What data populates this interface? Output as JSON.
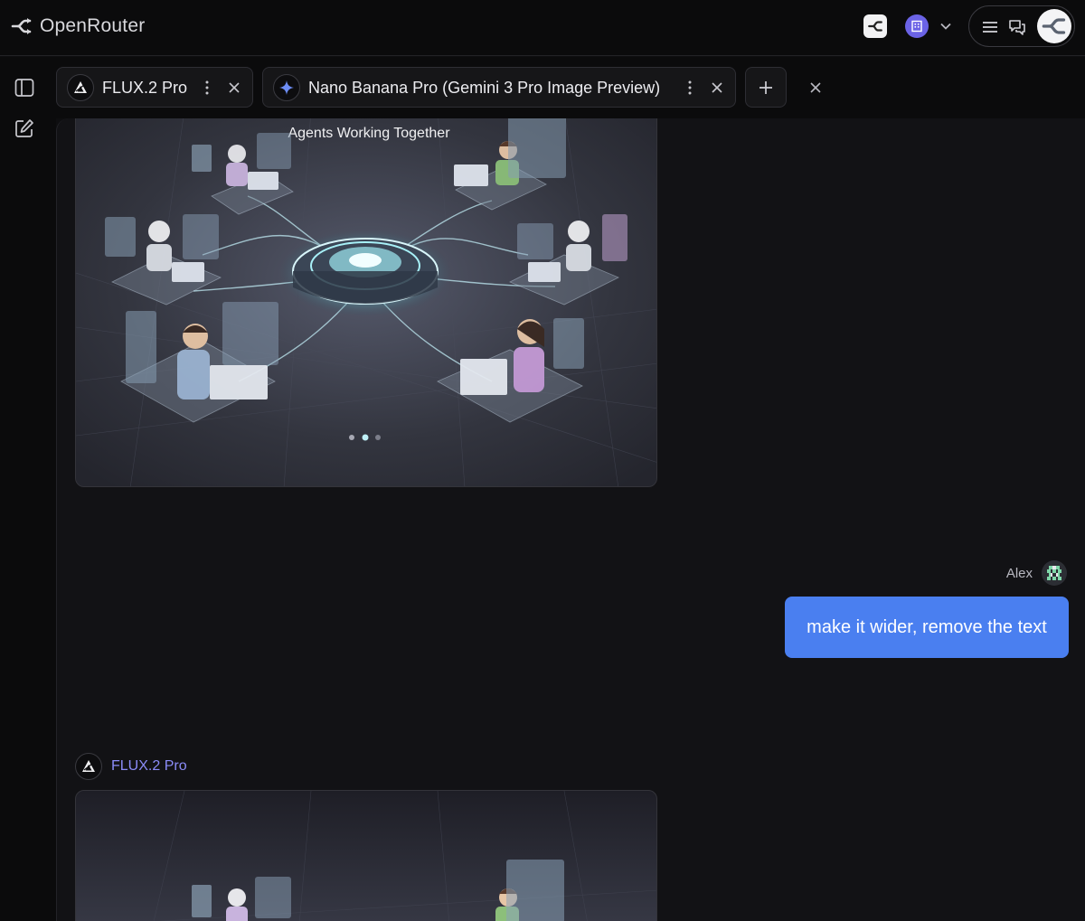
{
  "app": {
    "brand_name": "OpenRouter"
  },
  "colors": {
    "accent": "#4a7ff0",
    "model_link": "#8b8cf8",
    "org": "#6b63e6",
    "background": "#121215"
  },
  "header": {
    "icons": [
      "openrouter-logo-icon",
      "apps-icon",
      "organization-icon",
      "chevron-down-icon",
      "menu-icon",
      "chat-icon",
      "avatar"
    ]
  },
  "sidebar": {
    "icons": [
      "sidebar-toggle-icon",
      "new-chat-icon"
    ]
  },
  "tabs": [
    {
      "label": "FLUX.2 Pro",
      "icon": "flux-logo-icon"
    },
    {
      "label": "Nano Banana Pro (Gemini 3 Pro Image Preview)",
      "icon": "gemini-sparkle-icon"
    }
  ],
  "chat": {
    "image_caption": "Agents Working Together",
    "carousel": {
      "count": 3,
      "active": 2
    },
    "user": {
      "name": "Alex",
      "message": "make it wider, remove the text"
    },
    "reply": {
      "model_name": "FLUX.2 Pro"
    }
  }
}
